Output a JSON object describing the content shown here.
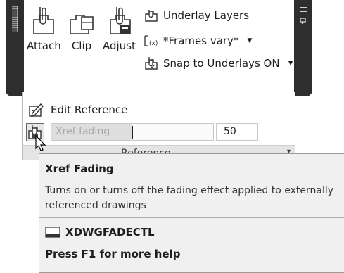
{
  "ribbon": {
    "buttons": {
      "attach": "Attach",
      "clip": "Clip",
      "adjust": "Adjust"
    },
    "underlay_layers": "Underlay Layers",
    "frames": "*Frames vary*",
    "snap": "Snap to Underlays ON"
  },
  "panel": {
    "edit_reference": "Edit Reference",
    "xref_fading_label": "Xref fading",
    "xref_fading_value": "50",
    "xref_fading_level": 50,
    "title": "Reference"
  },
  "tooltip": {
    "title": "Xref Fading",
    "description": "Turns on or turns off the fading effect applied to externally referenced drawings",
    "command": "XDWGFADECTL",
    "help": "Press F1 for more help"
  },
  "icons": [
    "grip-icon",
    "attach-icon",
    "clip-icon",
    "adjust-icon",
    "underlay-layers-icon",
    "frames-icon",
    "snap-icon",
    "pin-icon",
    "edit-reference-icon",
    "xref-fading-icon",
    "cursor-icon",
    "command-icon"
  ]
}
